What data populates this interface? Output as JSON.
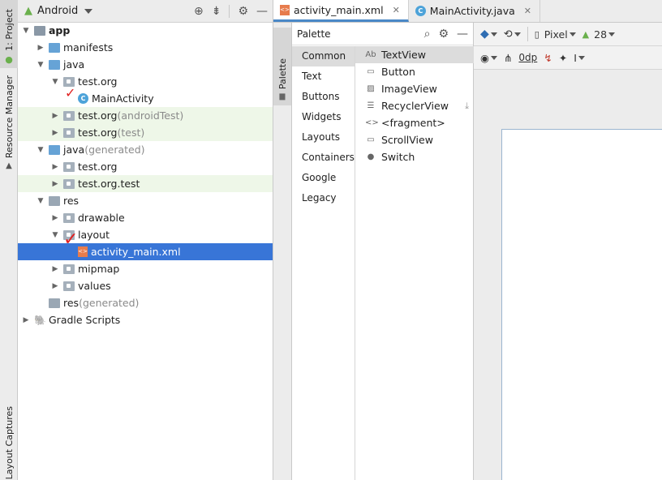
{
  "left_strip": {
    "tabs": [
      {
        "label": "1: Project"
      },
      {
        "label": "Resource Manager"
      },
      {
        "label": "Layout Captures"
      }
    ]
  },
  "project_panel": {
    "view_selector": "Android",
    "tree": [
      {
        "label": "app",
        "suffix": ""
      },
      {
        "label": "manifests",
        "suffix": ""
      },
      {
        "label": "java",
        "suffix": ""
      },
      {
        "label": "test.org",
        "suffix": ""
      },
      {
        "label": "MainActivity",
        "suffix": ""
      },
      {
        "label": "test.org",
        "suffix": " (androidTest)"
      },
      {
        "label": "test.org",
        "suffix": " (test)"
      },
      {
        "label": "java",
        "suffix": " (generated)"
      },
      {
        "label": "test.org",
        "suffix": ""
      },
      {
        "label": "test.org.test",
        "suffix": ""
      },
      {
        "label": "res",
        "suffix": ""
      },
      {
        "label": "drawable",
        "suffix": ""
      },
      {
        "label": "layout",
        "suffix": ""
      },
      {
        "label": "activity_main.xml",
        "suffix": ""
      },
      {
        "label": "mipmap",
        "suffix": ""
      },
      {
        "label": "values",
        "suffix": ""
      },
      {
        "label": "res",
        "suffix": " (generated)"
      },
      {
        "label": "Gradle Scripts",
        "suffix": ""
      }
    ],
    "selected_item": "activity_main.xml",
    "annotation_color": "#e02020"
  },
  "editor": {
    "tabs": [
      {
        "label": "activity_main.xml",
        "active": true
      },
      {
        "label": "MainActivity.java",
        "active": false
      }
    ],
    "palette_strip_label": "Palette",
    "palette": {
      "title": "Palette",
      "categories": [
        "Common",
        "Text",
        "Buttons",
        "Widgets",
        "Layouts",
        "Containers",
        "Google",
        "Legacy"
      ],
      "active_category": "Common",
      "items": [
        {
          "icon": "Ab",
          "label": "TextView"
        },
        {
          "icon": "▭",
          "label": "Button"
        },
        {
          "icon": "▨",
          "label": "ImageView"
        },
        {
          "icon": "☰",
          "label": "RecyclerView"
        },
        {
          "icon": "<>",
          "label": "<fragment>"
        },
        {
          "icon": "▭",
          "label": "ScrollView"
        },
        {
          "icon": "●",
          "label": "Switch"
        }
      ]
    },
    "design_toolbar": {
      "device": "Pixel",
      "api_level": "28",
      "margin": "0dp"
    }
  },
  "colors": {
    "selection": "#3875d7",
    "highlight_rows": "#eef7e8",
    "active_tab_underline": "#4a88c7"
  }
}
